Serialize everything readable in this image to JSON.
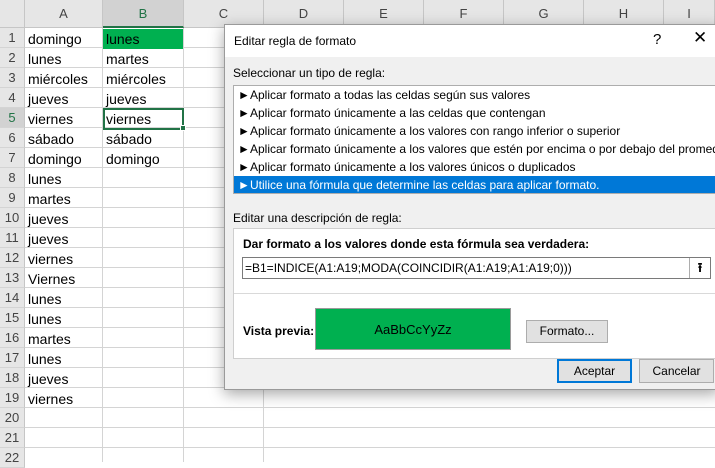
{
  "spreadsheet": {
    "columns": [
      "A",
      "B",
      "C",
      "D",
      "E",
      "F",
      "G",
      "H",
      "I"
    ],
    "selected_column": "B",
    "rows": [
      "1",
      "2",
      "3",
      "4",
      "5",
      "6",
      "7",
      "8",
      "9",
      "10",
      "11",
      "12",
      "13",
      "14",
      "15",
      "16",
      "17",
      "18",
      "19",
      "20",
      "21",
      "22"
    ],
    "selected_row": "5",
    "colA": [
      "domingo",
      "lunes",
      "miércoles",
      "jueves",
      "viernes",
      "sábado",
      "domingo",
      "lunes",
      "martes",
      "jueves",
      "jueves",
      "viernes",
      "Viernes",
      "lunes",
      "lunes",
      "martes",
      "lunes",
      "jueves",
      "viernes"
    ],
    "colB": [
      "lunes",
      "martes",
      "miércoles",
      "jueves",
      "viernes",
      "sábado",
      "domingo"
    ],
    "highlight_color": "#00b050"
  },
  "dialog": {
    "title": "Editar regla de formato",
    "help_icon": "?",
    "close_icon": "✕",
    "select_type_label": "Seleccionar un tipo de regla:",
    "rule_types": [
      "Aplicar formato a todas las celdas según sus valores",
      "Aplicar formato únicamente a las celdas que contengan",
      "Aplicar formato únicamente a los valores con rango inferior o superior",
      "Aplicar formato únicamente a los valores que estén por encima o por debajo del promedio",
      "Aplicar formato únicamente a los valores únicos o duplicados",
      "Utilice una fórmula que determine las celdas para aplicar formato."
    ],
    "selected_rule_index": 5,
    "edit_desc_label": "Editar una descripción de regla:",
    "formula_label": "Dar formato a los valores donde esta fórmula sea verdadera:",
    "formula_value": "=B1=INDICE(A1:A19;MODA(COINCIDIR(A1:A19;A1:A19;0)))",
    "preview_label": "Vista previa:",
    "preview_text": "AaBbCcYyZz",
    "preview_color": "#00b050",
    "format_button": "Formato...",
    "ok_button": "Aceptar",
    "cancel_button": "Cancelar",
    "accent_color": "#0078d7"
  }
}
